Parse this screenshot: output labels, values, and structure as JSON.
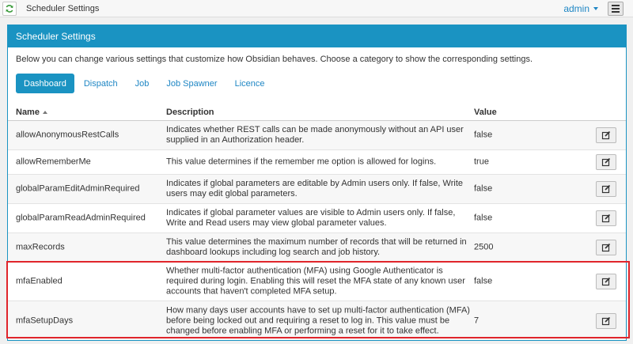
{
  "topbar": {
    "title": "Scheduler Settings",
    "user": "admin"
  },
  "panel": {
    "title": "Scheduler Settings",
    "intro": "Below you can change various settings that customize how Obsidian behaves. Choose a category to show the corresponding settings.",
    "tabs": [
      {
        "label": "Dashboard",
        "active": true
      },
      {
        "label": "Dispatch",
        "active": false
      },
      {
        "label": "Job",
        "active": false
      },
      {
        "label": "Job Spawner",
        "active": false
      },
      {
        "label": "Licence",
        "active": false
      }
    ]
  },
  "table": {
    "headers": {
      "name": "Name",
      "description": "Description",
      "value": "Value"
    },
    "rows": [
      {
        "name": "allowAnonymousRestCalls",
        "description": "Indicates whether REST calls can be made anonymously without an API user supplied in an Authorization header.",
        "value": "false"
      },
      {
        "name": "allowRememberMe",
        "description": "This value determines if the remember me option is allowed for logins.",
        "value": "true"
      },
      {
        "name": "globalParamEditAdminRequired",
        "description": "Indicates if global parameters are editable by Admin users only. If false, Write users may edit global parameters.",
        "value": "false"
      },
      {
        "name": "globalParamReadAdminRequired",
        "description": "Indicates if global parameter values are visible to Admin users only. If false, Write and Read users may view global parameter values.",
        "value": "false"
      },
      {
        "name": "maxRecords",
        "description": "This value determines the maximum number of records that will be returned in dashboard lookups including log search and job history.",
        "value": "2500"
      },
      {
        "name": "mfaEnabled",
        "description": "Whether multi-factor authentication (MFA) using Google Authenticator is required during login. Enabling this will reset the MFA state of any known user accounts that haven't completed MFA setup.",
        "value": "false"
      },
      {
        "name": "mfaSetupDays",
        "description": "How many days user accounts have to set up multi-factor authentication (MFA) before being locked out and requiring a reset to log in. This value must be changed before enabling MFA or performing a reset for it to take effect.",
        "value": "7"
      }
    ]
  },
  "colors": {
    "accent": "#1a93c2",
    "highlight": "#e0252b"
  }
}
